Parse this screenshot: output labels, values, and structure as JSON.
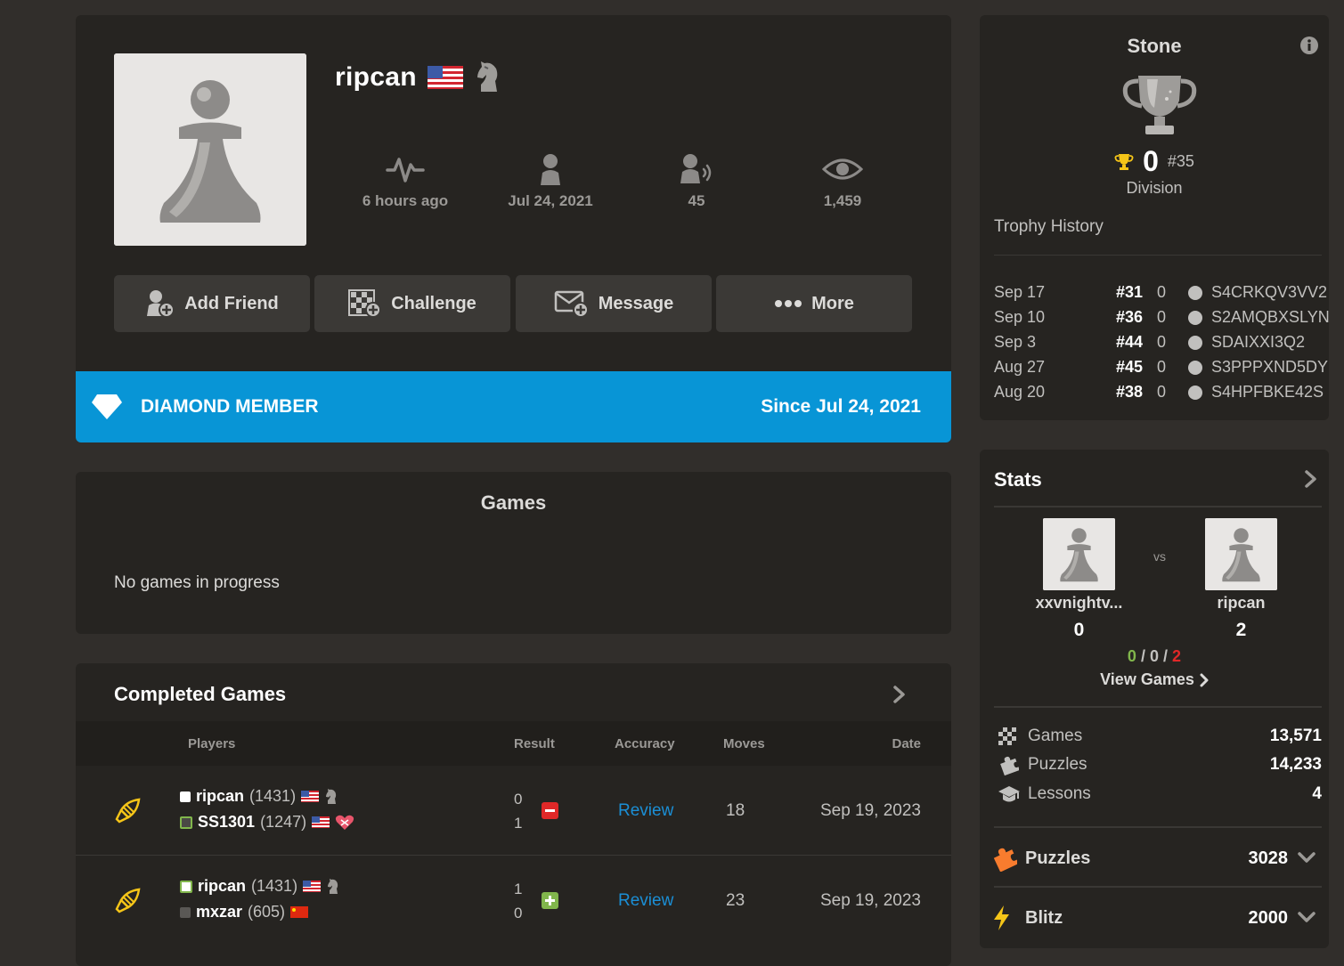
{
  "profile": {
    "username": "ripcan",
    "stats": [
      {
        "icon": "activity-icon",
        "value": "6 hours ago"
      },
      {
        "icon": "joined-icon",
        "value": "Jul 24, 2021"
      },
      {
        "icon": "friends-icon",
        "value": "45"
      },
      {
        "icon": "views-icon",
        "value": "1,459"
      }
    ],
    "actions": [
      {
        "label": "Add Friend",
        "icon": "add-friend-icon"
      },
      {
        "label": "Challenge",
        "icon": "challenge-icon"
      },
      {
        "label": "Message",
        "icon": "message-icon"
      },
      {
        "label": "More",
        "icon": "more-icon"
      }
    ],
    "membership": {
      "label": "DIAMOND MEMBER",
      "since": "Since Jul 24, 2021"
    }
  },
  "games": {
    "title": "Games",
    "empty_text": "No games in progress"
  },
  "completed": {
    "title": "Completed Games",
    "headers": {
      "players": "Players",
      "result": "Result",
      "accuracy": "Accuracy",
      "moves": "Moves",
      "date": "Date"
    },
    "rows": [
      {
        "white": {
          "name": "ripcan",
          "rating": "(1431)"
        },
        "black": {
          "name": "SS1301",
          "rating": "(1247)"
        },
        "score_top": "0",
        "score_bottom": "1",
        "result": "loss",
        "accuracy": "Review",
        "moves": "18",
        "date": "Sep 19, 2023"
      },
      {
        "white": {
          "name": "ripcan",
          "rating": "(1431)"
        },
        "black": {
          "name": "mxzar",
          "rating": "(605)"
        },
        "score_top": "1",
        "score_bottom": "0",
        "result": "win",
        "accuracy": "Review",
        "moves": "23",
        "date": "Sep 19, 2023"
      }
    ]
  },
  "league": {
    "title": "Stone",
    "trophies": "0",
    "rank": "#35",
    "division_label": "Division",
    "history_label": "Trophy History",
    "history": [
      {
        "date": "Sep 17",
        "rank": "#31",
        "trophies": "0",
        "code": "S4CRKQV3VV2"
      },
      {
        "date": "Sep 10",
        "rank": "#36",
        "trophies": "0",
        "code": "S2AMQBXSLYN"
      },
      {
        "date": "Sep 3",
        "rank": "#44",
        "trophies": "0",
        "code": "SDAIXXI3Q2"
      },
      {
        "date": "Aug 27",
        "rank": "#45",
        "trophies": "0",
        "code": "S3PPPXND5DY"
      },
      {
        "date": "Aug 20",
        "rank": "#38",
        "trophies": "0",
        "code": "S4HPFBKE42S"
      }
    ]
  },
  "stats": {
    "title": "Stats",
    "h2h": {
      "opponent": "xxvnightv...",
      "player": "ripcan",
      "vs": "vs",
      "opponent_score": "0",
      "player_score": "2",
      "wins": "0",
      "draws": "0",
      "losses": "2",
      "sep": "/",
      "view_games": "View Games"
    },
    "counts": [
      {
        "label": "Games",
        "value": "13,571",
        "icon": "games-icon"
      },
      {
        "label": "Puzzles",
        "value": "14,233",
        "icon": "puzzles-icon"
      },
      {
        "label": "Lessons",
        "value": "4",
        "icon": "lessons-icon"
      }
    ],
    "ratings": [
      {
        "label": "Puzzles",
        "value": "3028",
        "icon": "puzzle-rating-icon",
        "color": "#f87c2e"
      },
      {
        "label": "Blitz",
        "value": "2000",
        "icon": "blitz-icon",
        "color": "#f5c518"
      }
    ]
  },
  "colors": {
    "accent": "#0895d6",
    "review": "#1b8fd6",
    "win": "#81b64c",
    "loss": "#e02828",
    "background": "#312e2b",
    "panel": "#262421"
  }
}
